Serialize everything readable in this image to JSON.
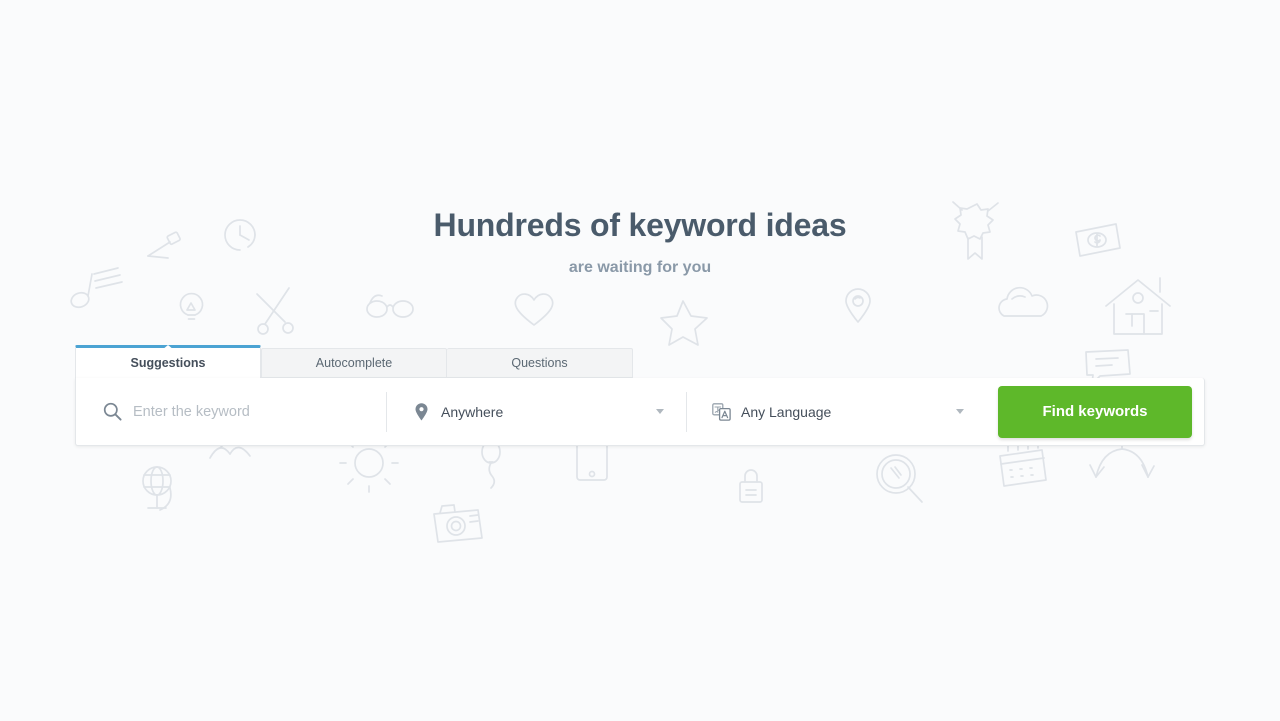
{
  "hero": {
    "title": "Hundreds of keyword ideas",
    "subtitle": "are waiting for you"
  },
  "search_widget": {
    "tabs": [
      {
        "label": "Suggestions",
        "active": true
      },
      {
        "label": "Autocomplete",
        "active": false
      },
      {
        "label": "Questions",
        "active": false
      }
    ],
    "keyword_field": {
      "icon": "search-icon",
      "placeholder": "Enter the keyword",
      "value": ""
    },
    "location_select": {
      "icon": "map-pin-icon",
      "selected": "Anywhere",
      "caret": "chevron-down-icon"
    },
    "language_select": {
      "icon": "translate-icon",
      "selected": "Any Language",
      "caret": "chevron-down-icon"
    },
    "submit_button": {
      "label": "Find keywords"
    }
  },
  "colors": {
    "page_background": "#fafbfc",
    "heading_text": "#4a5b6b",
    "subtitle_text": "#8a99a8",
    "active_tab_indicator": "#4ba3d3",
    "inactive_tab_background": "#f3f4f5",
    "panel_border": "#e4e7ea",
    "placeholder_text": "#b6bdc4",
    "submit_green": "#5eb82a",
    "doodle_stroke": "#dfe3e8"
  },
  "background_doodles": [
    "music-note-doodle-icon",
    "pen-doodle-icon",
    "stopwatch-doodle-icon",
    "lightbulb-doodle-icon",
    "scissors-doodle-icon",
    "glasses-doodle-icon",
    "heart-doodle-icon",
    "star-doodle-icon",
    "map-pin-doodle-icon",
    "award-ribbon-doodle-icon",
    "money-doodle-icon",
    "cloud-doodle-icon",
    "house-doodle-icon",
    "speech-bubble-doodle-icon",
    "globe-doodle-icon",
    "bird-doodle-icon",
    "sun-doodle-icon",
    "balloon-doodle-icon",
    "phone-doodle-icon",
    "camera-doodle-icon",
    "lock-doodle-icon",
    "magnifier-doodle-icon",
    "calendar-doodle-icon",
    "arrows-doodle-icon"
  ]
}
